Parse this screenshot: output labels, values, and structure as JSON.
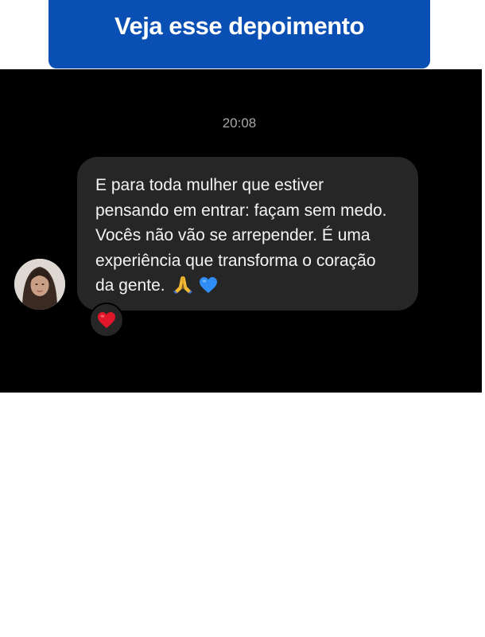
{
  "banner": {
    "title": "Veja esse depoimento"
  },
  "chat": {
    "timestamp": "20:08",
    "message": {
      "lines": [
        "E para toda mulher que estiver",
        "pensando em entrar: façam sem medo.",
        "Vocês não vão se arrepender. É uma",
        "experiência que transforma o coração",
        "da gente."
      ],
      "emojis": [
        "folded-hands",
        "blue-heart"
      ]
    },
    "reaction": "red-heart"
  },
  "colors": {
    "banner_bg": "#0a4fb4",
    "chat_bg": "#000000",
    "bubble_bg": "#262626",
    "heart_red": "#e0162b",
    "heart_blue": "#2f8df5"
  }
}
